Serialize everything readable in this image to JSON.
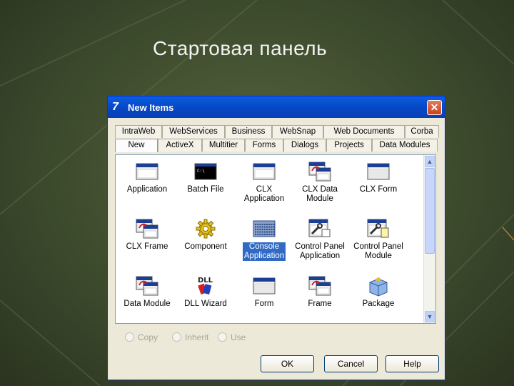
{
  "slide": {
    "title": "Стартовая панель"
  },
  "dialog": {
    "title": "New Items",
    "tabs_row1": [
      "IntraWeb",
      "WebServices",
      "Business",
      "WebSnap",
      "Web Documents",
      "Corba"
    ],
    "tabs_row2": [
      "New",
      "ActiveX",
      "Multitier",
      "Forms",
      "Dialogs",
      "Projects",
      "Data Modules"
    ],
    "active_tab": "New",
    "items": [
      {
        "label": "Application",
        "icon": "window-icon"
      },
      {
        "label": "Batch File",
        "icon": "console-icon"
      },
      {
        "label": "CLX\nApplication",
        "icon": "window-icon"
      },
      {
        "label": "CLX Data\nModule",
        "icon": "data-module-icon"
      },
      {
        "label": "CLX Form",
        "icon": "form-icon"
      },
      {
        "label": "CLX Frame",
        "icon": "frame-icon"
      },
      {
        "label": "Component",
        "icon": "gear-icon"
      },
      {
        "label": "Console\nApplication",
        "icon": "console-app-icon"
      },
      {
        "label": "Control Panel\nApplication",
        "icon": "control-panel-icon"
      },
      {
        "label": "Control Panel\nModule",
        "icon": "control-panel-module-icon"
      },
      {
        "label": "Data Module",
        "icon": "data-module-icon"
      },
      {
        "label": "DLL Wizard",
        "icon": "dll-icon"
      },
      {
        "label": "Form",
        "icon": "form-icon"
      },
      {
        "label": "Frame",
        "icon": "frame-icon"
      },
      {
        "label": "Package",
        "icon": "package-icon"
      }
    ],
    "selected_item": "Console\nApplication",
    "radios": [
      "Copy",
      "Inherit",
      "Use"
    ],
    "buttons": {
      "ok": "OK",
      "cancel": "Cancel",
      "help": "Help"
    },
    "close_label": "✕",
    "scroll_up": "▲",
    "scroll_down": "▼"
  }
}
